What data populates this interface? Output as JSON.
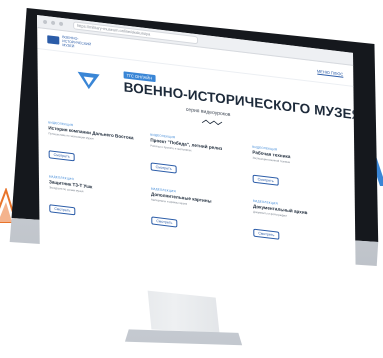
{
  "browser": {
    "url": "https://military-museum.online/ekskursiya"
  },
  "header": {
    "logo_text": "ВОЕННО-ИСТОРИЧЕСКИЙ МУЗЕЙ",
    "link": "МЕНЮ ПЛЮС"
  },
  "hero": {
    "badge": "ТГС ОНЛАЙН",
    "title": "ВОЕННО-ИСТОРИЧЕСКОГО МУЗЕЯ",
    "subtitle": "серия видеоуроков"
  },
  "cards": [
    {
      "label": "ВИДЕОЛЕКЦИЯ",
      "title": "История компании Дальнего Востока",
      "desc": "Путешествие по экспозиции музея",
      "button": "Смотреть"
    },
    {
      "label": "ВИДЕОЛЕКЦИЯ",
      "title": "Проект \"Победа\", летний релиз",
      "desc": "Рассказ о проекте и экспонатах",
      "button": "Смотреть"
    },
    {
      "label": "ВИДЕОЛЕКЦИЯ",
      "title": "Рабочая техника",
      "desc": "Экспозиция военной техники",
      "button": "Смотреть"
    },
    {
      "label": "ВИДЕОЛЕКЦИЯ",
      "title": "Защитник Т3-Т Ушк",
      "desc": "Экскурсия по залам музея",
      "button": "Смотреть"
    },
    {
      "label": "ВИДЕОЛЕКЦИЯ",
      "title": "Дополнительные картины",
      "desc": "Материалы и архивы музея",
      "button": "Смотреть"
    },
    {
      "label": "ВИДЕОЛЕКЦИЯ",
      "title": "Документальный архив",
      "desc": "Документы и фотографии",
      "button": "Смотреть"
    }
  ],
  "colors": {
    "accent": "#3a86d6",
    "brand": "#2b5ca8",
    "deco_orange": "#e8742b"
  }
}
